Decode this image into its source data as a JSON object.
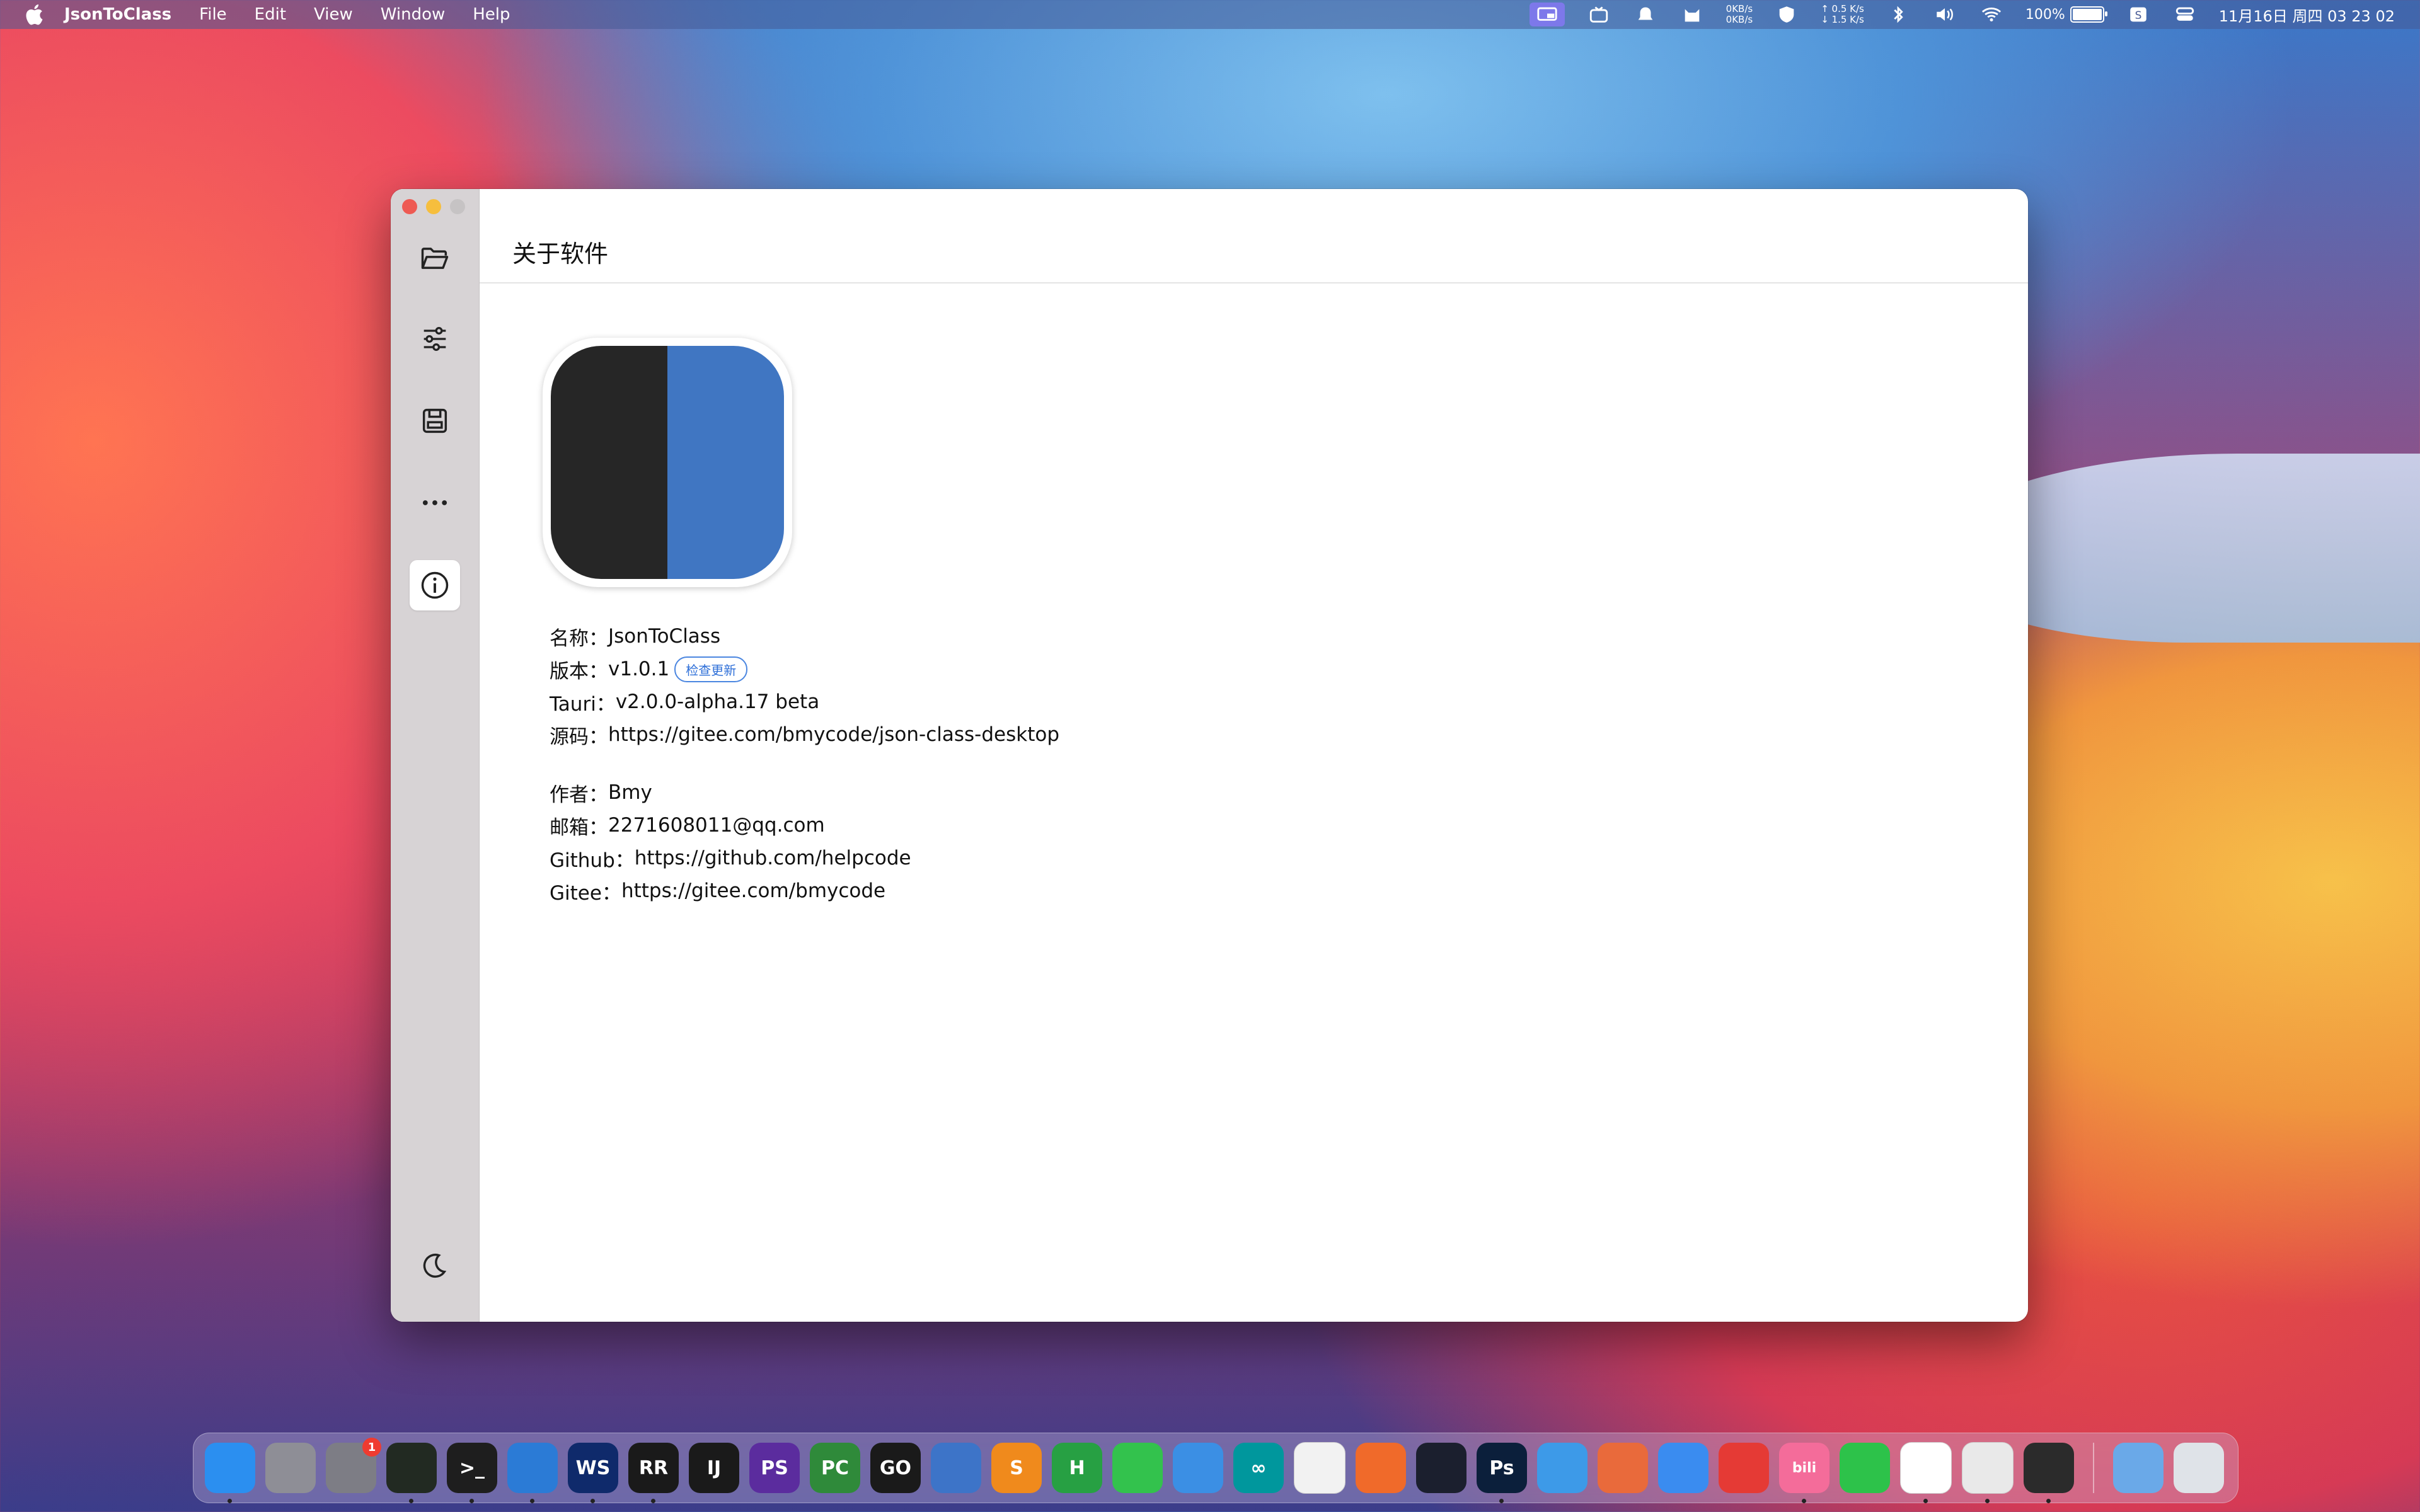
{
  "menubar": {
    "app_name": "JsonToClass",
    "menus": [
      "File",
      "Edit",
      "View",
      "Window",
      "Help"
    ],
    "net_in": "0KB/s",
    "net_out": "0KB/s",
    "net_up": "↑ 0.5 K/s",
    "net_down": "↓ 1.5 K/s",
    "battery_percent": "100%",
    "battery_level": 1.0,
    "clock": "11月16日 周四  03 23 02"
  },
  "window": {
    "page_title": "关于软件",
    "sidebar_icons": [
      "folder-icon",
      "sliders-icon",
      "save-icon",
      "more-icon",
      "info-icon",
      "moon-icon"
    ],
    "info": {
      "name_label": "名称：",
      "name_value": "JsonToClass",
      "version_label": "版本：",
      "version_value": "v1.0.1",
      "check_update": "检查更新",
      "tauri_label": "Tauri：",
      "tauri_value": "v2.0.0-alpha.17 beta",
      "source_label": "源码：",
      "source_value": "https://gitee.com/bmycode/json-class-desktop",
      "author_label": "作者：",
      "author_value": "Bmy",
      "email_label": "邮箱：",
      "email_value": "2271608011@qq.com",
      "github_label": "Github：",
      "github_value": "https://github.com/helpcode",
      "gitee_label": "Gitee：",
      "gitee_value": "https://gitee.com/bmycode"
    }
  },
  "dock": {
    "apps": [
      {
        "name": "finder-icon",
        "label": "",
        "color": "#2b8ff0",
        "dot": true
      },
      {
        "name": "launchpad-icon",
        "label": "",
        "color": "#8e8e96",
        "dot": false
      },
      {
        "name": "system-preferences-icon",
        "label": "",
        "color": "#7d7d85",
        "dot": false,
        "badge": "1"
      },
      {
        "name": "activity-monitor-icon",
        "label": "",
        "color": "#222a22",
        "dot": true
      },
      {
        "name": "terminal-icon",
        "label": ">_",
        "color": "#1e1e1e",
        "dot": true
      },
      {
        "name": "vscode-icon",
        "label": "",
        "color": "#2b7bd6",
        "dot": true
      },
      {
        "name": "webstorm-icon",
        "label": "WS",
        "color": "#0f2a6b",
        "dot": true
      },
      {
        "name": "rider-icon",
        "label": "RR",
        "color": "#1a1a1a",
        "dot": true
      },
      {
        "name": "intellij-icon",
        "label": "IJ",
        "color": "#1a1a1a",
        "dot": false
      },
      {
        "name": "phpstorm-icon",
        "label": "PS",
        "color": "#5b2c9e",
        "dot": false
      },
      {
        "name": "pycharm-icon",
        "label": "PC",
        "color": "#2f8a3a",
        "dot": false
      },
      {
        "name": "goland-icon",
        "label": "GO",
        "color": "#1a1a1a",
        "dot": false
      },
      {
        "name": "instruments-icon",
        "label": "",
        "color": "#3d74c8",
        "dot": false
      },
      {
        "name": "sublime-icon",
        "label": "S",
        "color": "#f08a1c",
        "dot": false
      },
      {
        "name": "hbuilder-icon",
        "label": "H",
        "color": "#27a043",
        "dot": false
      },
      {
        "name": "messages-icon",
        "label": "",
        "color": "#33c24d",
        "dot": false
      },
      {
        "name": "xcode-icon",
        "label": "",
        "color": "#3b8fe4",
        "dot": false
      },
      {
        "name": "arduino-icon",
        "label": "∞",
        "color": "#00979d",
        "dot": false
      },
      {
        "name": "photos-icon",
        "label": "",
        "color": "#f2f2f2",
        "dot": false
      },
      {
        "name": "pen-app-icon",
        "label": "",
        "color": "#f06a2a",
        "dot": false
      },
      {
        "name": "openai-icon",
        "label": "",
        "color": "#1b1f2e",
        "dot": false
      },
      {
        "name": "photoshop-icon",
        "label": "Ps",
        "color": "#0b1f3b",
        "dot": true
      },
      {
        "name": "database-icon",
        "label": "",
        "color": "#3d9ae8",
        "dot": false
      },
      {
        "name": "html-app-icon",
        "label": "",
        "color": "#e96a3b",
        "dot": false
      },
      {
        "name": "cat-app-icon",
        "label": "",
        "color": "#3a8cf0",
        "dot": false
      },
      {
        "name": "netease-music-icon",
        "label": "",
        "color": "#e53a35",
        "dot": false
      },
      {
        "name": "bilibili-icon",
        "label": "bili",
        "color": "#f46c9a",
        "dot": true
      },
      {
        "name": "wechat-icon",
        "label": "",
        "color": "#2dc24a",
        "dot": false
      },
      {
        "name": "qq-icon",
        "label": "",
        "color": "#ffffff",
        "dot": true
      },
      {
        "name": "chrome-icon",
        "label": "",
        "color": "#e9e9e9",
        "dot": true
      },
      {
        "name": "jsontoclass-icon",
        "label": "",
        "color": "#2b2b2b",
        "dot": true
      }
    ],
    "extras": [
      {
        "name": "downloads-folder-icon",
        "color": "#6aa9e8"
      },
      {
        "name": "trash-icon",
        "color": "#dfe3e8"
      }
    ]
  }
}
